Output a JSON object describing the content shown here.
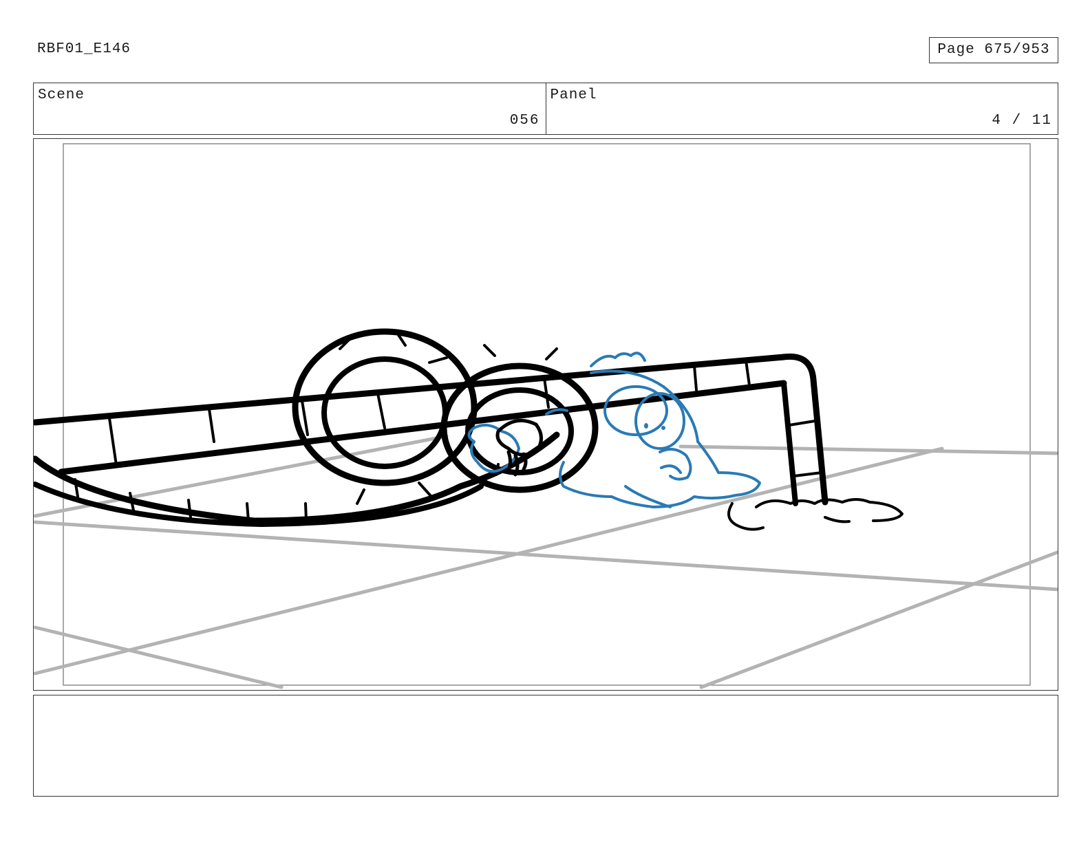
{
  "header": {
    "doc_id": "RBF01_E146",
    "page": "Page 675/953"
  },
  "scene": {
    "label": "Scene",
    "value": "056"
  },
  "panel": {
    "label": "Panel",
    "value": "4 / 11"
  },
  "artwork": {
    "ink_color": "#000000",
    "character_color": "#2a7ab5",
    "floor_color": "#b3b3b3",
    "safe_frame_color": "#8c8c8c"
  },
  "notes": {
    "text": ""
  }
}
